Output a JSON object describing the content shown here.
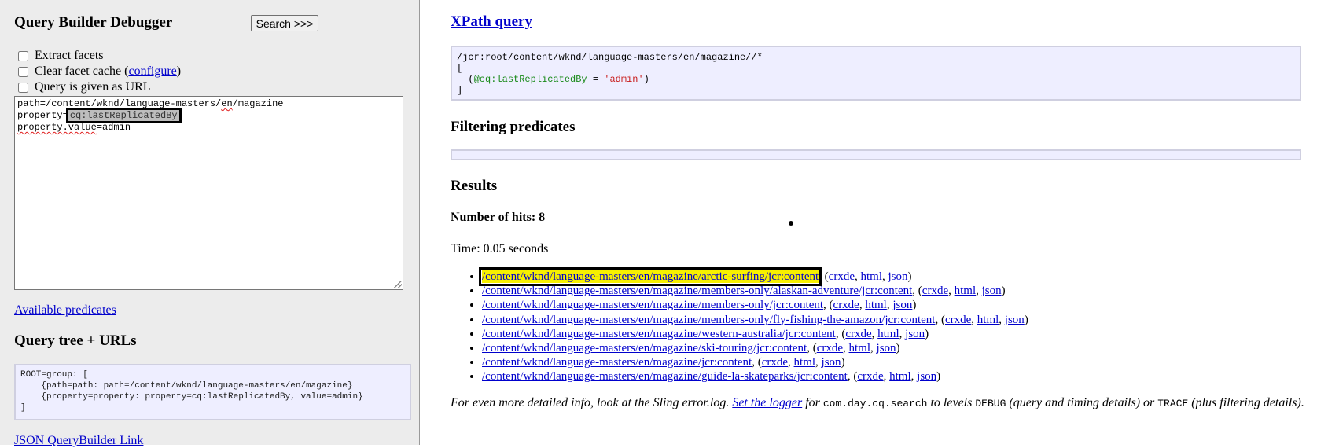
{
  "left": {
    "title": "Query Builder Debugger",
    "search_label": "Search >>>",
    "checkboxes": {
      "extract_facets": "Extract facets",
      "clear_cache_prefix": "Clear facet cache (",
      "configure_link": "configure",
      "clear_cache_suffix": ")",
      "query_url": "Query is given as URL"
    },
    "query": {
      "l1_a": "path=/content/wknd/language-masters/",
      "l1_b": "en",
      "l1_c": "/magazine",
      "l2_a": "property=",
      "l2_b": "cq:lastReplicatedBy",
      "l3_a": "property.value",
      "l3_b": "=admin"
    },
    "available_predicates": "Available predicates",
    "query_tree_title": "Query tree + URLs",
    "query_tree": [
      "ROOT=group: [",
      "    {path=path: path=/content/wknd/language-masters/en/magazine}",
      "    {property=property: property=cq:lastReplicatedBy, value=admin}",
      "]"
    ],
    "json_link": "JSON QueryBuilder Link"
  },
  "right": {
    "xpath_title": "XPath query",
    "xpath": {
      "line1": "/jcr:root/content/wknd/language-masters/en/magazine//*",
      "line2": "[",
      "line3_open": "  (",
      "line3_attr": "@cq:lastReplicatedBy",
      "line3_eq": " = ",
      "line3_val": "'admin'",
      "line3_close": ")",
      "line4": "]"
    },
    "filtering_title": "Filtering predicates",
    "results_title": "Results",
    "hits": "Number of hits: 8",
    "time": "Time: 0.05 seconds",
    "results": [
      {
        "path": "/content/wknd/language-masters/en/magazine/arctic-surfing/jcr:content"
      },
      {
        "path": "/content/wknd/language-masters/en/magazine/members-only/alaskan-adventure/jcr:content"
      },
      {
        "path": "/content/wknd/language-masters/en/magazine/members-only/jcr:content"
      },
      {
        "path": "/content/wknd/language-masters/en/magazine/members-only/fly-fishing-the-amazon/jcr:content"
      },
      {
        "path": "/content/wknd/language-masters/en/magazine/western-australia/jcr:content"
      },
      {
        "path": "/content/wknd/language-masters/en/magazine/ski-touring/jcr:content"
      },
      {
        "path": "/content/wknd/language-masters/en/magazine/jcr:content"
      },
      {
        "path": "/content/wknd/language-masters/en/magazine/guide-la-skateparks/jcr:content"
      }
    ],
    "link_crxde": "crxde",
    "link_html": "html",
    "link_json": "json",
    "sep_open": ", (",
    "sep_comma": ", ",
    "sep_close": ")",
    "footnote": {
      "t1": "For even more detailed info, look at the Sling error.log. ",
      "link": "Set the logger",
      "t2": " for ",
      "code1": "com.day.cq.search",
      "t3": " to levels ",
      "code2": "DEBUG",
      "t4": " (query and timing details) or ",
      "code3": "TRACE",
      "t5": " (plus filtering details)."
    }
  },
  "colors": {
    "panel_bg": "#ececec",
    "box_bg": "#eeeeff",
    "link": "#0000cc",
    "highlight": "#f7f000"
  }
}
